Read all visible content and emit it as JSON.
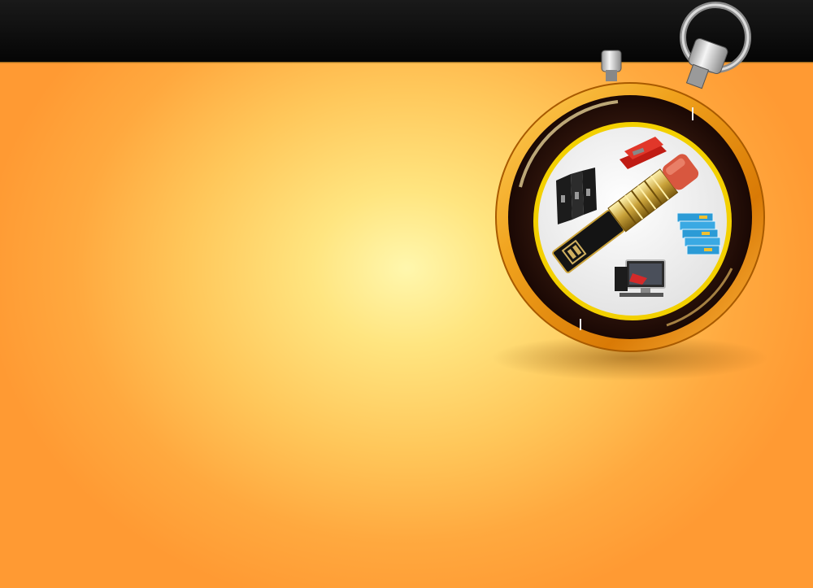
{
  "header": {
    "background_color": "#0b0b0b"
  },
  "background": {
    "center_color": "#fff7ad",
    "edge_color": "#ff9a33"
  },
  "illustration": {
    "subject": "stopwatch-with-office-supplies",
    "items": [
      "pencil-icon",
      "stapler-icon",
      "binders-icon",
      "file-folders-icon",
      "computer-icon"
    ],
    "ring_color": "#e08a10",
    "face_color": "#3a1b0e",
    "inner_border_color": "#f3d000"
  }
}
